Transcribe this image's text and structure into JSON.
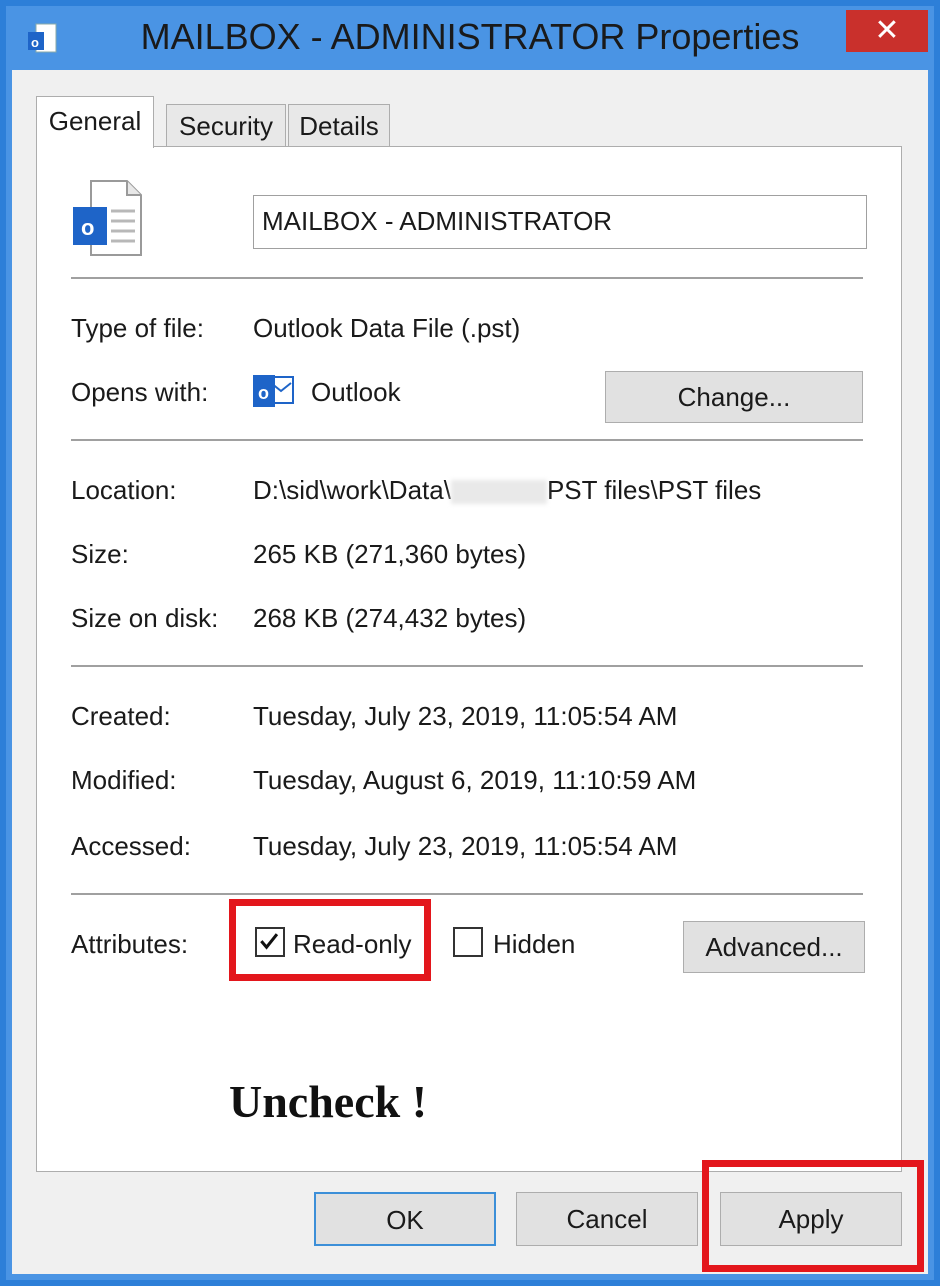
{
  "window": {
    "title": "MAILBOX - ADMINISTRATOR Properties",
    "close_label": "✕"
  },
  "tabs": [
    {
      "label": "General"
    },
    {
      "label": "Security"
    },
    {
      "label": "Details"
    }
  ],
  "general": {
    "name": "MAILBOX - ADMINISTRATOR",
    "type_label": "Type of file:",
    "type_value": "Outlook Data File (.pst)",
    "opens_label": "Opens with:",
    "opens_value": "Outlook",
    "change_button": "Change...",
    "location_label": "Location:",
    "location_prefix": "D:\\sid\\work\\Data\\",
    "location_suffix": "PST files\\PST files",
    "size_label": "Size:",
    "size_value": "265 KB (271,360 bytes)",
    "size_disk_label": "Size on disk:",
    "size_disk_value": "268 KB (274,432 bytes)",
    "created_label": "Created:",
    "created_value": "Tuesday, July 23, 2019, 11:05:54 AM",
    "modified_label": "Modified:",
    "modified_value": "Tuesday, August 6, 2019, 11:10:59 AM",
    "accessed_label": "Accessed:",
    "accessed_value": "Tuesday, July 23, 2019, 11:05:54 AM",
    "attributes_label": "Attributes:",
    "readonly_label": "Read-only",
    "readonly_checked": true,
    "hidden_label": "Hidden",
    "hidden_checked": false,
    "advanced_button": "Advanced...",
    "annotation": "Uncheck !"
  },
  "buttons": {
    "ok": "OK",
    "cancel": "Cancel",
    "apply": "Apply"
  },
  "colors": {
    "frame": "#4a94e4",
    "close": "#c9302c",
    "highlight": "#e3161c",
    "outlook_blue": "#1e64c8"
  }
}
